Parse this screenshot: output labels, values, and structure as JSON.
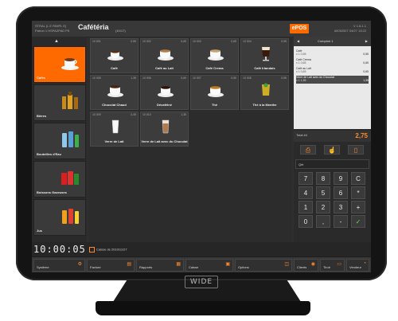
{
  "app": {
    "user_line1": "STRAL (L E RIMPL E)",
    "user_line2": "Patron 1 HSPAZPAD P5",
    "title": "Cafétéria",
    "title_count": "(10/17)",
    "logo": "ePOS",
    "right_line1": "V 1.8.1.1",
    "right_line2": "#0052527 04/27 13:22"
  },
  "categories": [
    {
      "label": "Cafés",
      "icon": "coffee-cup-icon",
      "active": true
    },
    {
      "label": "Bières",
      "icon": "beer-bottles-icon",
      "active": false
    },
    {
      "label": "Bouteilles d'Eau",
      "icon": "water-bottles-icon",
      "active": false
    },
    {
      "label": "Boissons Gazeuses",
      "icon": "soda-cans-icon",
      "active": false
    },
    {
      "label": "Jus",
      "icon": "juice-bottles-icon",
      "active": false
    }
  ],
  "products": [
    {
      "code": "10 001",
      "price": "0,55",
      "name": "Café",
      "icon": "espresso-cup-icon"
    },
    {
      "code": "10 002",
      "price": "0,65",
      "name": "Café au Lait",
      "icon": "coffee-cup-icon"
    },
    {
      "code": "10 003",
      "price": "0,65",
      "name": "Café Crema",
      "icon": "coffee-crema-icon"
    },
    {
      "code": "10 004",
      "price": "0,95",
      "name": "Café Irlandais",
      "icon": "irish-coffee-icon"
    },
    {
      "code": "10 005",
      "price": "1,35",
      "name": "Chocolat Chaud",
      "icon": "hot-chocolate-icon"
    },
    {
      "code": "10 006",
      "price": "0,60",
      "name": "Décaféiné",
      "icon": "decaf-cup-icon"
    },
    {
      "code": "10 007",
      "price": "0,50",
      "name": "Thé",
      "icon": "tea-cup-icon"
    },
    {
      "code": "10 008",
      "price": "0,55",
      "name": "Thé à la Menthe",
      "icon": "mint-tea-icon"
    },
    {
      "code": "10 009",
      "price": "0,45",
      "name": "Verre de Lait",
      "icon": "milk-glass-icon"
    },
    {
      "code": "10 010",
      "price": "1,35",
      "name": "Verre de Lait avec du Chocolat",
      "icon": "chocolate-milk-icon"
    }
  ],
  "ticket": {
    "header_left": "◀",
    "header_mid": "Comptoir 1",
    "header_right": "▶",
    "lines": [
      {
        "name": "Café",
        "qty": "x 1 0,95",
        "price": "0,55",
        "selected": false
      },
      {
        "name": "Café Crema",
        "qty": "x 1 0,65",
        "price": "0,65",
        "selected": false
      },
      {
        "name": "Café au Lait",
        "qty": "x 1 0,65",
        "price": "0,65",
        "selected": false
      },
      {
        "name": "Verre de Lait avec du Chocolat",
        "qty": "x 1 1,35",
        "price": "1,35",
        "selected": true
      }
    ],
    "total_label": "Total #4",
    "total_value": "2,75"
  },
  "qty_label": "Qté",
  "keypad": [
    "7",
    "8",
    "9",
    "C",
    "4",
    "5",
    "6",
    "*",
    "1",
    "2",
    "3",
    "+",
    "0",
    ",",
    "-",
    "✓"
  ],
  "sell_button": "1 - Lait Pressé",
  "clock": "10:00:05",
  "caisse_label": "Caisse de 2010/11/27",
  "menu": [
    {
      "label": "Système",
      "icon": "gear-icon"
    },
    {
      "label": "Facture",
      "icon": "document-icon"
    },
    {
      "label": "Rapports",
      "icon": "report-icon"
    },
    {
      "label": "Caisse",
      "icon": "cash-drawer-icon"
    },
    {
      "label": "Options",
      "icon": "options-icon"
    },
    {
      "label": "Clients",
      "icon": "clients-icon"
    },
    {
      "label": "Tiroir",
      "icon": "drawer-icon"
    },
    {
      "label": "Vendeur",
      "icon": "vendor-icon"
    }
  ],
  "brand": "WIDE",
  "colors": {
    "accent": "#ff6a00",
    "ok": "#6fd94a"
  }
}
